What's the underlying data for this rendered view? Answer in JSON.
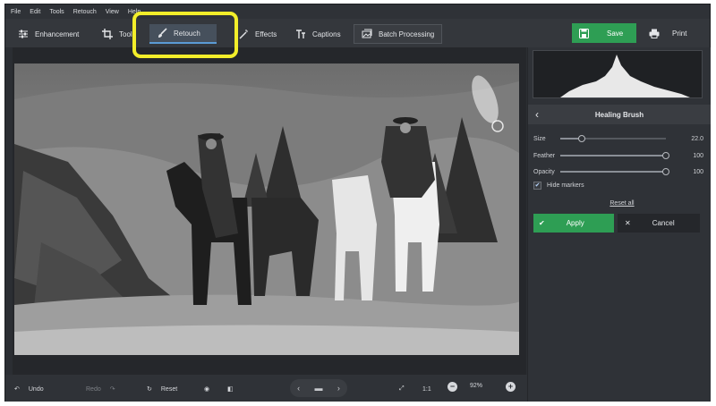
{
  "menu": [
    "File",
    "Edit",
    "Tools",
    "Retouch",
    "View",
    "Help"
  ],
  "toolbar": {
    "tabs": [
      {
        "label": "Enhancement",
        "icon": "sliders-icon"
      },
      {
        "label": "Tools",
        "icon": "crop-icon"
      },
      {
        "label": "Retouch",
        "icon": "brush-icon",
        "active": true
      },
      {
        "label": "Effects",
        "icon": "wand-icon"
      },
      {
        "label": "Captions",
        "icon": "text-icon"
      }
    ],
    "batch_label": "Batch Processing",
    "save_label": "Save",
    "print_label": "Print"
  },
  "panel": {
    "title": "Healing Brush",
    "sliders": [
      {
        "label": "Size",
        "value": "22.0",
        "fraction": 0.2
      },
      {
        "label": "Feather",
        "value": "100",
        "fraction": 1.0
      },
      {
        "label": "Opacity",
        "value": "100",
        "fraction": 1.0
      }
    ],
    "hide_markers_label": "Hide markers",
    "hide_markers_checked": true,
    "reset_all_label": "Reset all",
    "apply_label": "Apply",
    "cancel_label": "Cancel"
  },
  "bottombar": {
    "undo_label": "Undo",
    "redo_label": "Redo",
    "reset_label": "Reset",
    "ratio_label": "1:1",
    "zoom_value": "92%"
  },
  "colors": {
    "accent_green": "#2e9e54",
    "highlight_yellow": "#f3ee2a",
    "bg_dark": "#2b2e33"
  }
}
